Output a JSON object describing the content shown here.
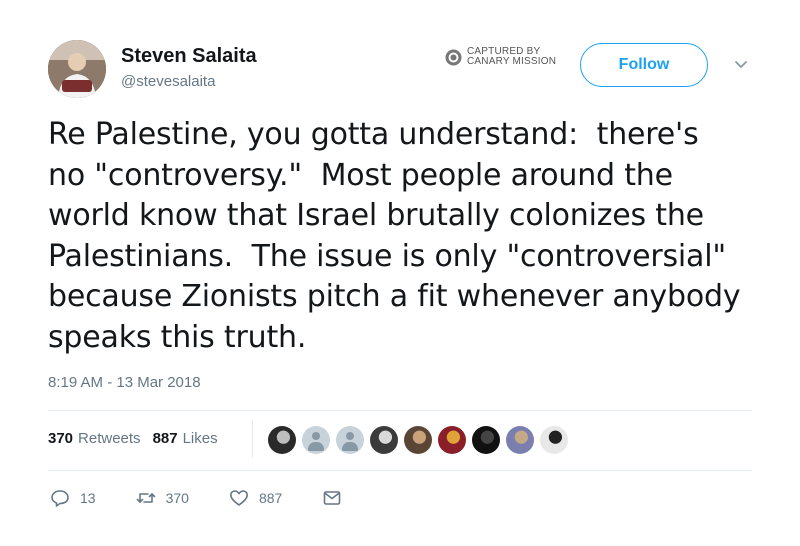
{
  "author": {
    "display_name": "Steven Salaita",
    "handle": "@stevesalaita"
  },
  "watermark": {
    "line1": "CAPTURED BY",
    "line2": "CANARY MISSION"
  },
  "follow_label": "Follow",
  "tweet": {
    "lines": [
      "Re Palestine, you gotta understand:  there's",
      "no \"controversy.\"  Most people around the",
      "world know that Israel brutally colonizes the",
      "Palestinians.  The issue is only \"controversial\"",
      "because Zionists pitch a fit whenever anybody",
      "speaks this truth."
    ],
    "timestamp": "8:19 AM - 13 Mar 2018"
  },
  "stats": {
    "retweets_count": "370",
    "retweets_label": "Retweets",
    "likes_count": "887",
    "likes_label": "Likes"
  },
  "likers": [
    {
      "kind": "photo",
      "colors": [
        "#2a2a2a",
        "#bdbdbd"
      ]
    },
    {
      "kind": "default"
    },
    {
      "kind": "default"
    },
    {
      "kind": "photo",
      "colors": [
        "#3b3b3b",
        "#d9d9d9"
      ]
    },
    {
      "kind": "photo",
      "colors": [
        "#5b4636",
        "#c9a27a"
      ]
    },
    {
      "kind": "photo",
      "colors": [
        "#8a1f2a",
        "#e0a33a"
      ]
    },
    {
      "kind": "photo",
      "colors": [
        "#111111",
        "#444444"
      ]
    },
    {
      "kind": "photo",
      "colors": [
        "#7a7fb0",
        "#c5a884"
      ]
    },
    {
      "kind": "photo",
      "colors": [
        "#e8e8e8",
        "#222222"
      ]
    }
  ],
  "actions": {
    "reply_count": "13",
    "retweet_count": "370",
    "like_count": "887"
  },
  "colors": {
    "accent": "#1da1f2",
    "secondary_text": "#657786",
    "divider": "#e6ecf0"
  }
}
